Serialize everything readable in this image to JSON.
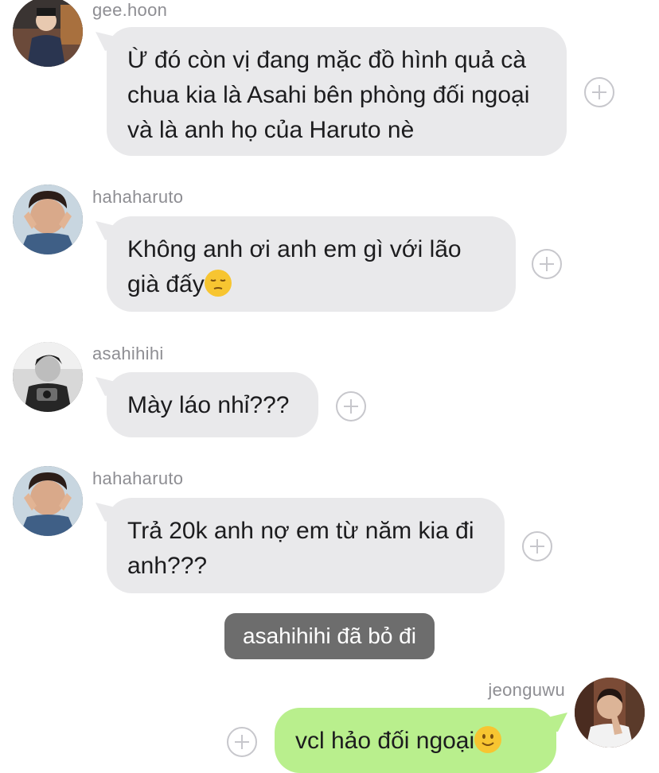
{
  "messages": [
    {
      "user": "gee.hoon",
      "text": "Ừ đó còn vị đang mặc đồ hình quả cà chua kia là Asahi bên phòng đối ngoại và là anh họ của Haruto nè"
    },
    {
      "user": "hahaharuto",
      "text": "Không anh ơi anh em gì với lão già đấy",
      "emoji": "pensive-face"
    },
    {
      "user": "asahihihi",
      "text": "Mày láo nhỉ???"
    },
    {
      "user": "hahaharuto",
      "text": "Trả 20k anh nợ em từ năm kia đi anh???"
    },
    {
      "user": "jeonguwu",
      "text": "vcl hảo đối ngoại",
      "emoji": "slightly-smiling-face"
    }
  ],
  "system_notice": "asahihihi đã bỏ đi",
  "colors": {
    "incoming_bubble": "#e9e9eb",
    "outgoing_bubble": "#b9ef8d",
    "system_bubble": "#6d6d6d",
    "username": "#8e8e93"
  },
  "icons": {
    "react": "plus-circle-icon"
  }
}
